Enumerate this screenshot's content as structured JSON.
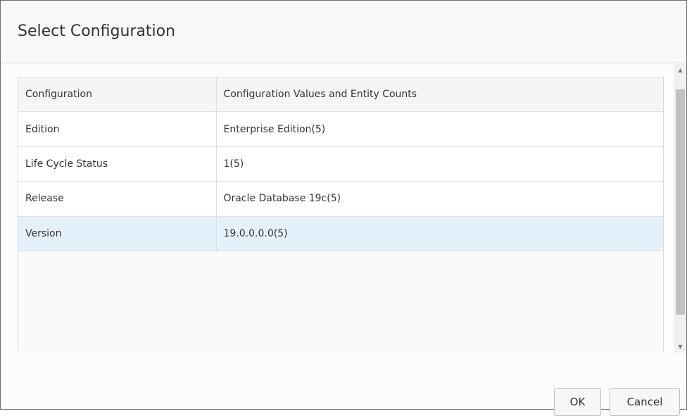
{
  "dialog": {
    "title": "Select Configuration"
  },
  "table": {
    "headers": [
      "Configuration",
      "Configuration Values and Entity Counts"
    ],
    "rows": [
      {
        "configuration": "Edition",
        "value": "Enterprise Edition(5)"
      },
      {
        "configuration": "Life Cycle Status",
        "value": "1(5)"
      },
      {
        "configuration": "Release",
        "value": "Oracle Database 19c(5)"
      },
      {
        "configuration": "Version",
        "value": "19.0.0.0.0(5)",
        "selected": true
      }
    ]
  },
  "scrollbar": {
    "up_icon": "▲",
    "down_icon": "▼"
  },
  "buttons": {
    "ok_label": "OK",
    "cancel_label": "Cancel"
  },
  "colors": {
    "selected_row": "#e5f1fa",
    "dialog_border": "#6e6e6e"
  }
}
